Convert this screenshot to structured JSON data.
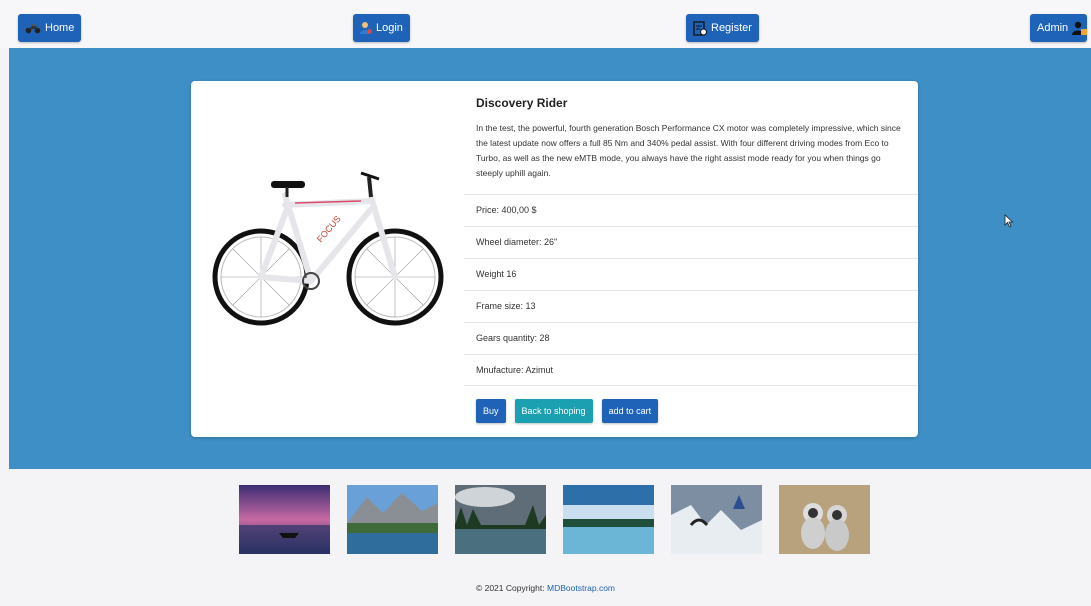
{
  "nav": {
    "home_label": "Home",
    "login_label": "Login",
    "register_label": "Register",
    "admin_label": "Admin"
  },
  "product": {
    "title": "Discovery Rider",
    "description": "In the test, the powerful, fourth generation Bosch Performance CX motor was completely impressive, which since the latest update now offers a full 85 Nm and 340% pedal assist. With four different driving modes from Eco to Turbo, as well as the new eMTB mode, you always have the right assist mode ready for you when things go steeply uphill again.",
    "specs": [
      "Price: 400,00 $",
      "Wheel diameter: 26\"",
      "Weight 16",
      "Frame size: 13",
      "Gears quantity: 28",
      "Mnufacture: Azimut"
    ],
    "buy_label": "Buy",
    "back_label": "Back to shoping",
    "cart_label": "add to cart"
  },
  "footer": {
    "copyright": "© 2021 Copyright:",
    "link": "MDBootstrap.com"
  },
  "colors": {
    "primary": "#1e63b8",
    "hero_bg": "#3d8fc5",
    "teal": "#1aa0b1"
  }
}
